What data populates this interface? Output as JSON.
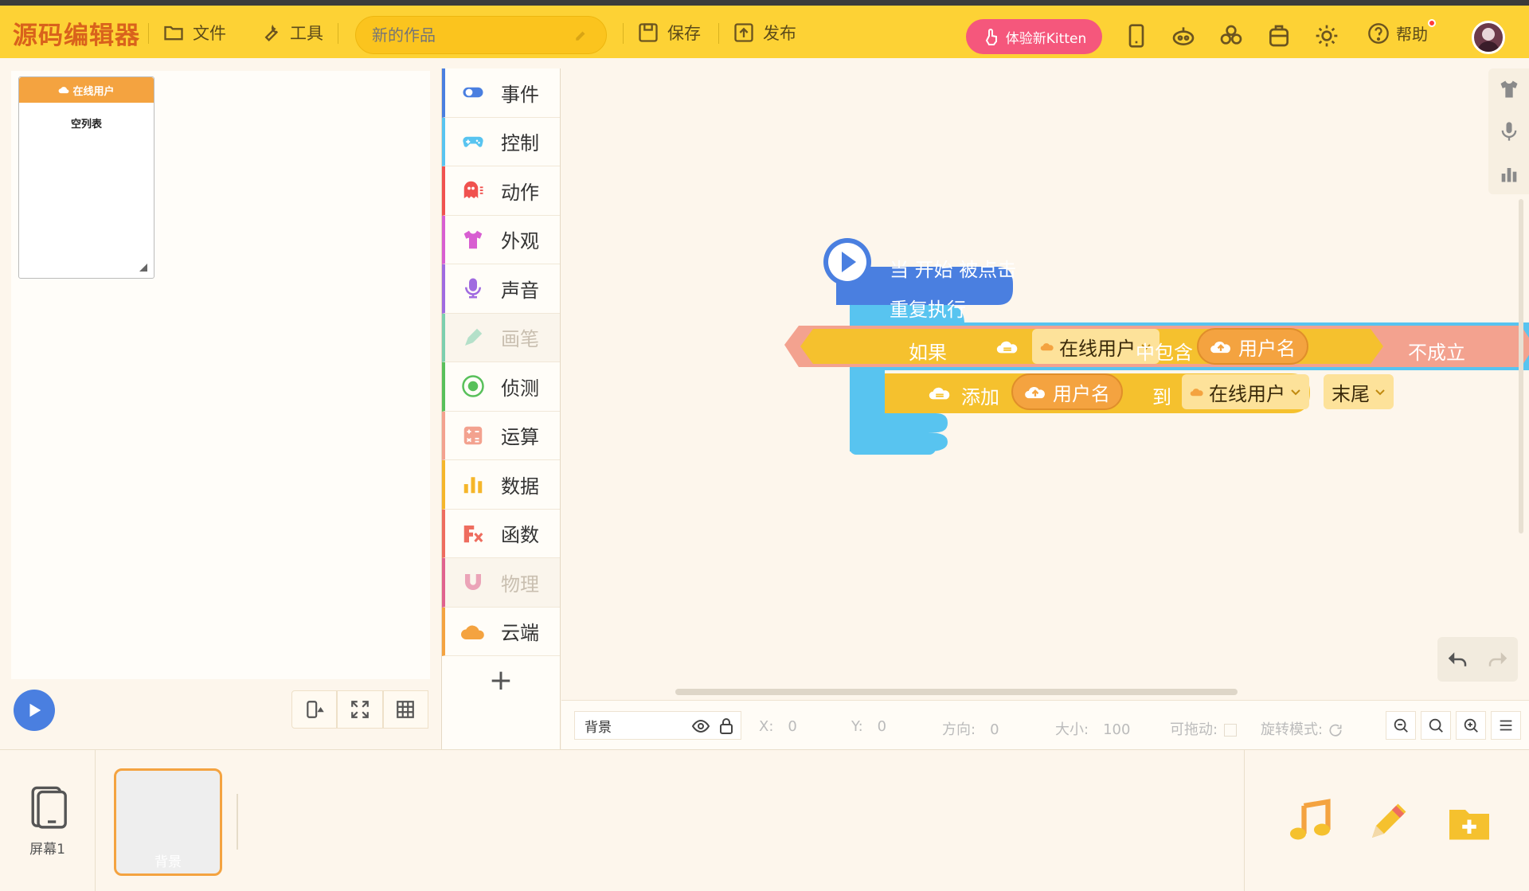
{
  "app": {
    "logo": "源码编辑器",
    "menu_file": "文件",
    "menu_tools": "工具",
    "project_title_placeholder": "新的作品",
    "save": "保存",
    "publish": "发布",
    "try_kitten": "体验新Kitten",
    "help": "帮助"
  },
  "stage": {
    "list_widget": {
      "title": "在线用户",
      "empty_text": "空列表"
    }
  },
  "categories": [
    {
      "label": "事件",
      "color": "#4a7fe0",
      "icon": "toggle-icon",
      "enabled": true
    },
    {
      "label": "控制",
      "color": "#58c4f0",
      "icon": "gamepad-icon",
      "enabled": true
    },
    {
      "label": "动作",
      "color": "#f0524f",
      "icon": "ghost-icon",
      "enabled": true
    },
    {
      "label": "外观",
      "color": "#d85ed1",
      "icon": "shirt-icon",
      "enabled": true
    },
    {
      "label": "声音",
      "color": "#a06be0",
      "icon": "microphone-icon",
      "enabled": true
    },
    {
      "label": "画笔",
      "color": "#7ccfae",
      "icon": "pen-icon",
      "enabled": false
    },
    {
      "label": "侦测",
      "color": "#58c05a",
      "icon": "radar-icon",
      "enabled": true
    },
    {
      "label": "运算",
      "color": "#f3a28f",
      "icon": "calculator-icon",
      "enabled": true
    },
    {
      "label": "数据",
      "color": "#f5b62a",
      "icon": "bar-chart-icon",
      "enabled": true
    },
    {
      "label": "函数",
      "color": "#ee6d5f",
      "icon": "function-icon",
      "enabled": true
    },
    {
      "label": "物理",
      "color": "#e0628e",
      "icon": "magnet-icon",
      "enabled": false
    },
    {
      "label": "云端",
      "color": "#f4a340",
      "icon": "cloud-icon",
      "enabled": true
    }
  ],
  "blocks": {
    "hat": "当 开始 被点击",
    "repeat": "重复执行",
    "if_label": "如果",
    "list_var": "在线用户",
    "contains": "中包含",
    "var_username": "用户名",
    "not_true": "不成立",
    "add": "添加",
    "to": "到",
    "end_position": "末尾"
  },
  "props": {
    "sprite_name": "背景",
    "x_label": "X:",
    "x": "0",
    "y_label": "Y:",
    "y": "0",
    "dir_label": "方向:",
    "dir": "0",
    "size_label": "大小:",
    "size": "100",
    "drag_label": "可拖动:",
    "rotate_label": "旋转模式:"
  },
  "bottom": {
    "screen_label": "屏幕1",
    "bg_label": "背景"
  },
  "colors": {
    "topbar": "#fdd235",
    "event_blue": "#4a7fe0",
    "control_blue": "#58c4f0",
    "data_yellow": "#f5c12e",
    "cloud_orange": "#f4a340",
    "operator_salmon": "#f3a28f",
    "kitten_pink": "#f5577c"
  }
}
